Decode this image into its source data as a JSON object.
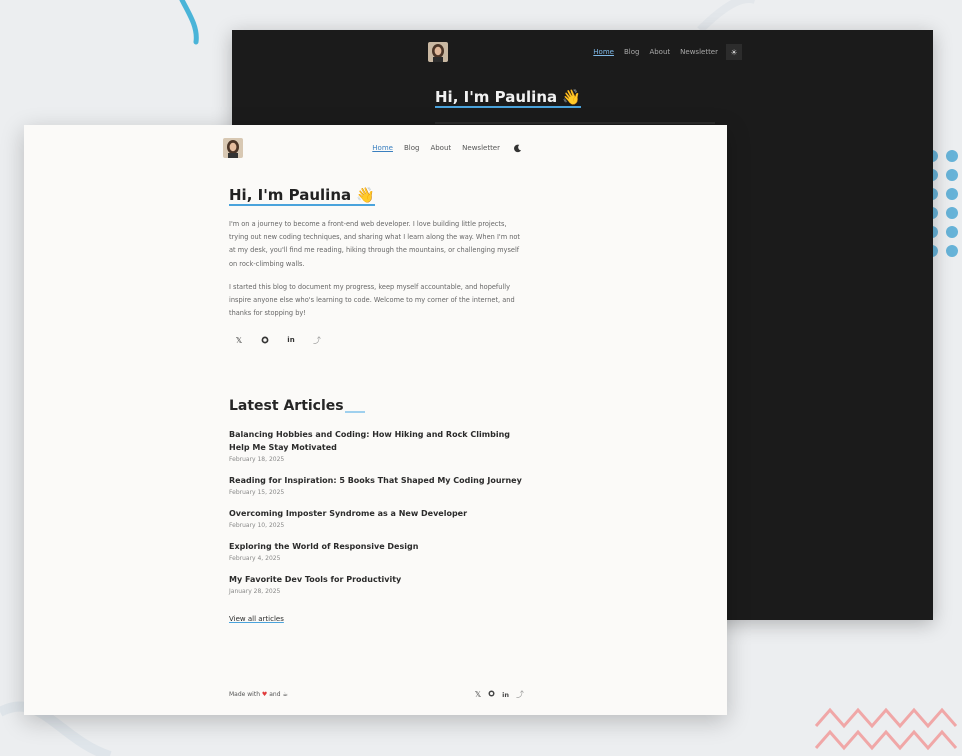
{
  "dark_preview": {
    "nav": {
      "items": [
        "Home",
        "Blog",
        "About",
        "Newsletter"
      ],
      "theme_toggle_icon": "sun-icon"
    },
    "hero_title": "Hi, I'm Paulina 👋"
  },
  "nav": {
    "items": [
      "Home",
      "Blog",
      "About",
      "Newsletter"
    ],
    "active": "Home",
    "theme_toggle_icon": "moon-icon"
  },
  "hero": {
    "title": "Hi, I'm Paulina 👋",
    "paragraphs": [
      "I'm on a journey to become a front-end web developer. I love building little projects, trying out new coding techniques, and sharing what I learn along the way. When I'm not at my desk, you'll find me reading, hiking through the mountains, or challenging myself on rock-climbing walls.",
      "I started this blog to document my progress, keep myself accountable, and hopefully inspire anyone else who's learning to code. Welcome to my corner of the internet, and thanks for stopping by!"
    ],
    "social_icons": [
      "x-icon",
      "github-icon",
      "linkedin-icon",
      "frontend-mentor-icon"
    ]
  },
  "latest": {
    "heading": "Latest Articles",
    "articles": [
      {
        "title": "Balancing Hobbies and Coding: How Hiking and Rock Climbing Help Me Stay Motivated",
        "date": "February 18, 2025"
      },
      {
        "title": "Reading for Inspiration: 5 Books That Shaped My Coding Journey",
        "date": "February 15, 2025"
      },
      {
        "title": "Overcoming Imposter Syndrome as a New Developer",
        "date": "February 10, 2025"
      },
      {
        "title": "Exploring the World of Responsive Design",
        "date": "February 4, 2025"
      },
      {
        "title": "My Favorite Dev Tools for Productivity",
        "date": "January 28, 2025"
      }
    ],
    "view_all": "View all articles"
  },
  "footer": {
    "made_with_prefix": "Made with",
    "made_with_and": "and",
    "icons": [
      "x-icon",
      "github-icon",
      "linkedin-icon",
      "frontend-mentor-icon"
    ]
  },
  "colors": {
    "accent": "#4aa3dc",
    "dark_bg": "#1b1b1b",
    "light_bg": "#fbfaf8",
    "page_bg": "#eceef0",
    "deco_dots": "#67b3d8",
    "deco_zigzag": "#f0a7a7"
  }
}
